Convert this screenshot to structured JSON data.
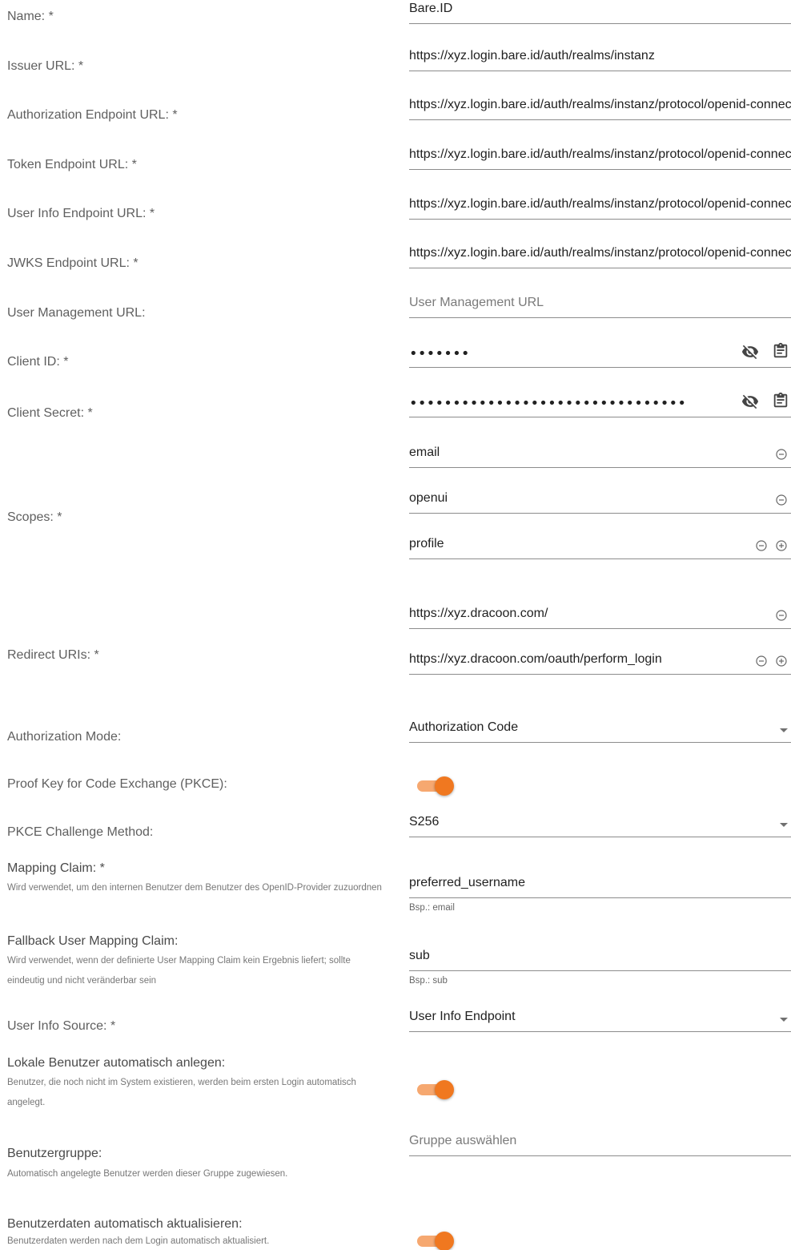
{
  "labels": {
    "name": "Name: *",
    "issuer": "Issuer URL: *",
    "auth_endpoint": "Authorization Endpoint URL: *",
    "token_endpoint": "Token Endpoint URL: *",
    "userinfo_endpoint": "User Info Endpoint URL: *",
    "jwks_endpoint": "JWKS Endpoint URL: *",
    "user_mgmt": "User Management URL:",
    "client_id": "Client ID: *",
    "client_secret": "Client Secret: *",
    "scopes": "Scopes: *",
    "redirect_uris": "Redirect URIs: *",
    "auth_mode": "Authorization Mode:",
    "pkce": "Proof Key for Code Exchange (PKCE):",
    "pkce_method": "PKCE Challenge Method:",
    "mapping_claim": "Mapping Claim: *",
    "mapping_claim_desc": "Wird verwendet, um den internen Benutzer dem Benutzer des OpenID-Provider zuzuordnen",
    "fallback_claim": "Fallback User Mapping Claim:",
    "fallback_claim_desc": "Wird verwendet, wenn der definierte User Mapping Claim kein Ergebnis liefert; sollte eindeutig und nicht veränderbar sein",
    "userinfo_source": "User Info Source: *",
    "auto_create": "Lokale Benutzer automatisch anlegen:",
    "auto_create_desc": "Benutzer, die noch nicht im System existieren, werden beim ersten Login automatisch angelegt.",
    "user_group": "Benutzergruppe:",
    "user_group_desc": "Automatisch angelegte Benutzer werden dieser Gruppe zugewiesen.",
    "auto_update": "Benutzerdaten automatisch aktualisieren:",
    "auto_update_desc": "Benutzerdaten werden nach dem Login automatisch aktualisiert."
  },
  "values": {
    "name": "Bare.ID",
    "issuer": "https://xyz.login.bare.id/auth/realms/instanz",
    "auth_endpoint": "https://xyz.login.bare.id/auth/realms/instanz/protocol/openid-connect/auth",
    "token_endpoint": "https://xyz.login.bare.id/auth/realms/instanz/protocol/openid-connect/token",
    "userinfo_endpoint": "https://xyz.login.bare.id/auth/realms/instanz/protocol/openid-connect/userinfo",
    "jwks_endpoint": "https://xyz.login.bare.id/auth/realms/instanz/protocol/openid-connect/certs",
    "user_mgmt_placeholder": "User Management URL",
    "client_id_masked": "•••••••",
    "client_secret_masked": "••••••••••••••••••••••••••••••••",
    "scopes": [
      "email",
      "openui",
      "profile"
    ],
    "redirect_uris": [
      "https://xyz.dracoon.com/",
      "https://xyz.dracoon.com/oauth/perform_login"
    ],
    "auth_mode": "Authorization Code",
    "pkce_enabled": true,
    "pkce_method": "S256",
    "mapping_claim": "preferred_username",
    "mapping_claim_hint": "Bsp.: email",
    "fallback_claim": "sub",
    "fallback_claim_hint": "Bsp.: sub",
    "userinfo_source": "User Info Endpoint",
    "auto_create_enabled": true,
    "user_group_placeholder": "Gruppe auswählen",
    "auto_update_enabled": true
  },
  "icons": {
    "visibility_off": "eye-off-icon",
    "clipboard": "clipboard-icon",
    "remove": "minus-circle-icon",
    "add": "plus-circle-icon",
    "dropdown": "caret-down-icon"
  },
  "colors": {
    "accent": "#f07820",
    "accent_track": "#f6a870",
    "label": "#5f5f5f",
    "underline": "#8c8c8c"
  }
}
